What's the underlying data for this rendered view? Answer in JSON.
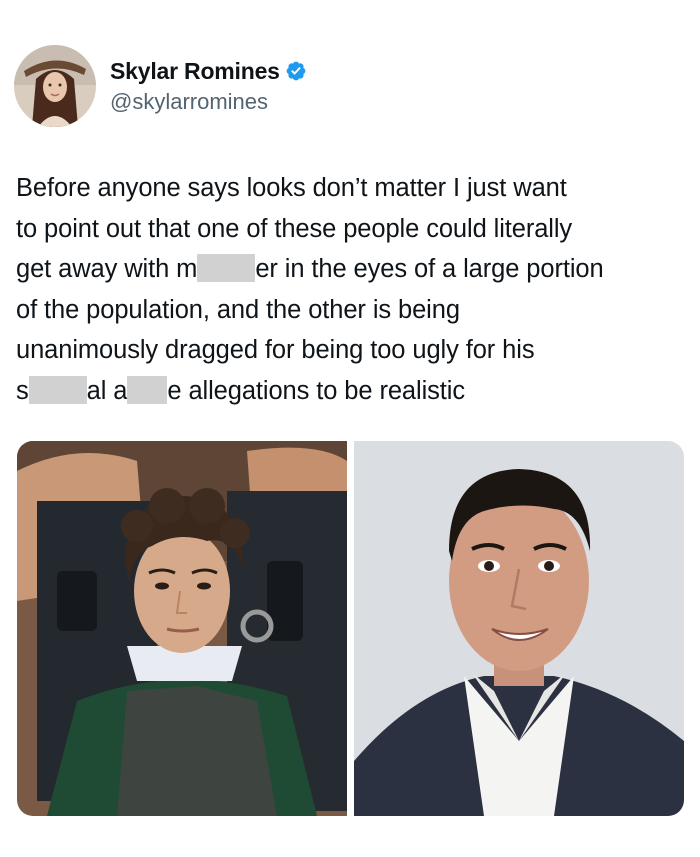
{
  "tweet": {
    "author": {
      "display_name": "Skylar Romines",
      "handle": "@skylarromines",
      "verified": true,
      "avatar_icon": "avatar-photo-icon"
    },
    "text_lines": [
      [
        "Before anyone says looks don’t matter I just want"
      ],
      [
        "to point out that one of these people could literally"
      ],
      [
        "get away with m",
        "er in the eyes of a large portion"
      ],
      [
        "of the population, and the other is being"
      ],
      [
        "unanimously dragged for being too ugly for his"
      ],
      [
        "s",
        "al a",
        "e allegations to be realistic"
      ]
    ],
    "media": {
      "left_photo_icon": "man-curly-hair-in-custody-photo",
      "right_photo_icon": "man-in-suit-headshot-photo"
    },
    "colors": {
      "text": "#0f1419",
      "secondary_text": "#536471",
      "verified_badge": "#1d9bf0",
      "censor_blur": "#c9c9c9"
    }
  }
}
